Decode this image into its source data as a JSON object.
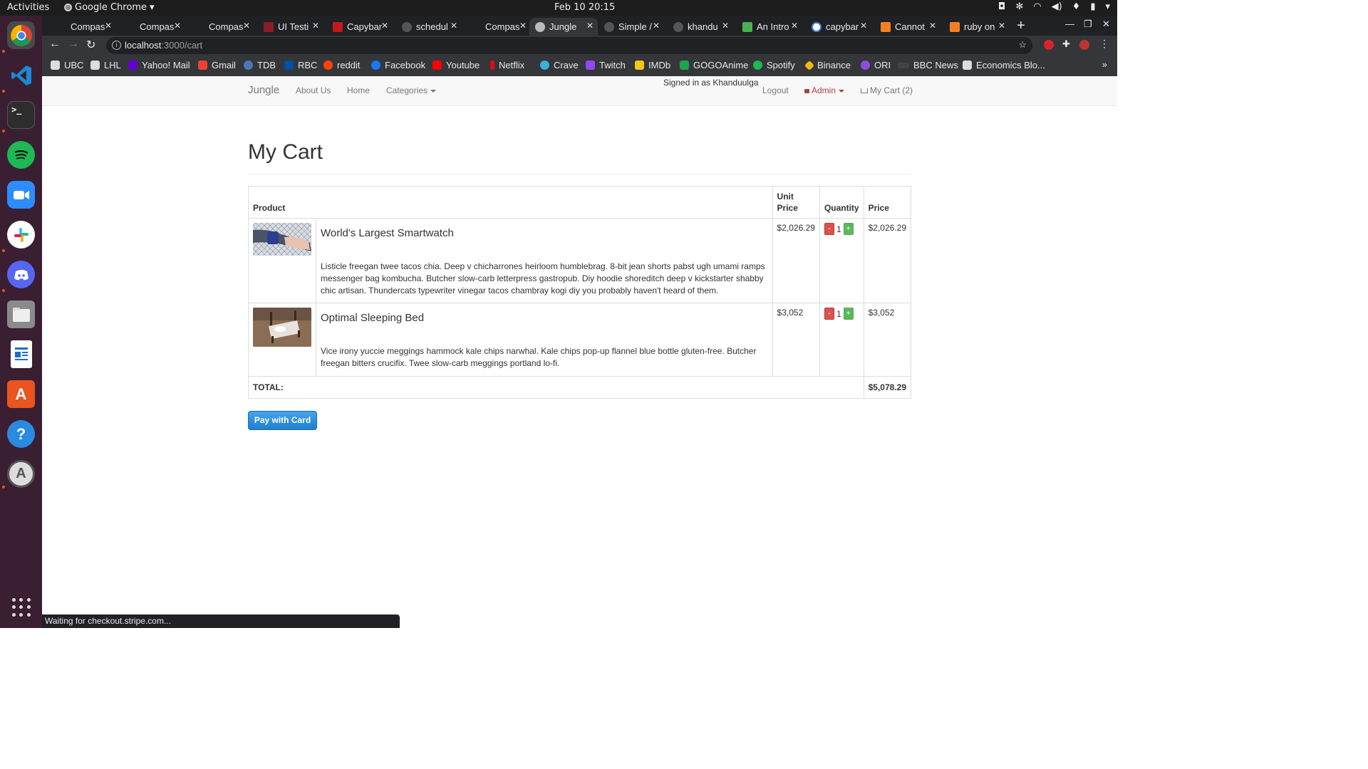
{
  "topbar": {
    "activities": "Activities",
    "app_name": "Google Chrome",
    "clock": "Feb 10  20:15"
  },
  "dock": {
    "items": [
      "chrome-icon",
      "vscode-icon",
      "terminal-icon",
      "spotify-icon",
      "zoom-icon",
      "slack-icon",
      "discord-icon",
      "files-icon",
      "writer-icon",
      "software-icon",
      "help-icon",
      "updater-icon"
    ]
  },
  "tabs": [
    {
      "title": "Compas",
      "active": false
    },
    {
      "title": "Compas",
      "active": false
    },
    {
      "title": "Compas",
      "active": false
    },
    {
      "title": "UI Testi",
      "active": false
    },
    {
      "title": "Capybar",
      "active": false
    },
    {
      "title": "schedul",
      "active": false
    },
    {
      "title": "Compas",
      "active": false
    },
    {
      "title": "Jungle",
      "active": true
    },
    {
      "title": "Simple /",
      "active": false
    },
    {
      "title": "khandu",
      "active": false
    },
    {
      "title": "An Intro",
      "active": false
    },
    {
      "title": "capybar",
      "active": false
    },
    {
      "title": "Cannot",
      "active": false
    },
    {
      "title": "ruby on",
      "active": false
    }
  ],
  "omnibox": {
    "host": "localhost",
    "path": ":3000/cart"
  },
  "bookmarks": [
    "UBC",
    "LHL",
    "Yahoo! Mail",
    "Gmail",
    "TDB",
    "RBC",
    "reddit",
    "Facebook",
    "Youtube",
    "Netflix",
    "Crave",
    "Twitch",
    "IMDb",
    "GOGOAnime",
    "Spotify",
    "Binance",
    "ORI",
    "BBC News",
    "Economics Blo..."
  ],
  "navbar": {
    "brand": "Jungle",
    "about": "About Us",
    "home": "Home",
    "categories": "Categories",
    "signed_in": "Signed in as Khanduulga",
    "logout": "Logout",
    "admin": "Admin",
    "cart": "My Cart (2)"
  },
  "cart": {
    "title": "My Cart",
    "headers": {
      "product": "Product",
      "unit_price_1": "Unit",
      "unit_price_2": "Price",
      "quantity": "Quantity",
      "price": "Price"
    },
    "items": [
      {
        "name": "World's Largest Smartwatch",
        "description": "Listicle freegan twee tacos chia. Deep v chicharrones heirloom humblebrag. 8-bit jean shorts pabst ugh umami ramps messenger bag kombucha. Butcher slow-carb letterpress gastropub. Diy hoodie shoreditch deep v kickstarter shabby chic artisan. Thundercats typewriter vinegar tacos chambray kogi diy you probably haven't heard of them.",
        "unit_price": "$2,026.29",
        "quantity": "1",
        "price": "$2,026.29"
      },
      {
        "name": "Optimal Sleeping Bed",
        "description": "Vice irony yuccie meggings hammock kale chips narwhal. Kale chips pop-up flannel blue bottle gluten-free. Butcher freegan bitters crucifix. Twee slow-carb meggings portland lo-fi.",
        "unit_price": "$3,052",
        "quantity": "1",
        "price": "$3,052"
      }
    ],
    "minus_label": "-",
    "plus_label": "+",
    "total_label": "TOTAL:",
    "total_value": "$5,078.29",
    "pay_button": "Pay with Card"
  },
  "status": "Waiting for checkout.stripe.com..."
}
